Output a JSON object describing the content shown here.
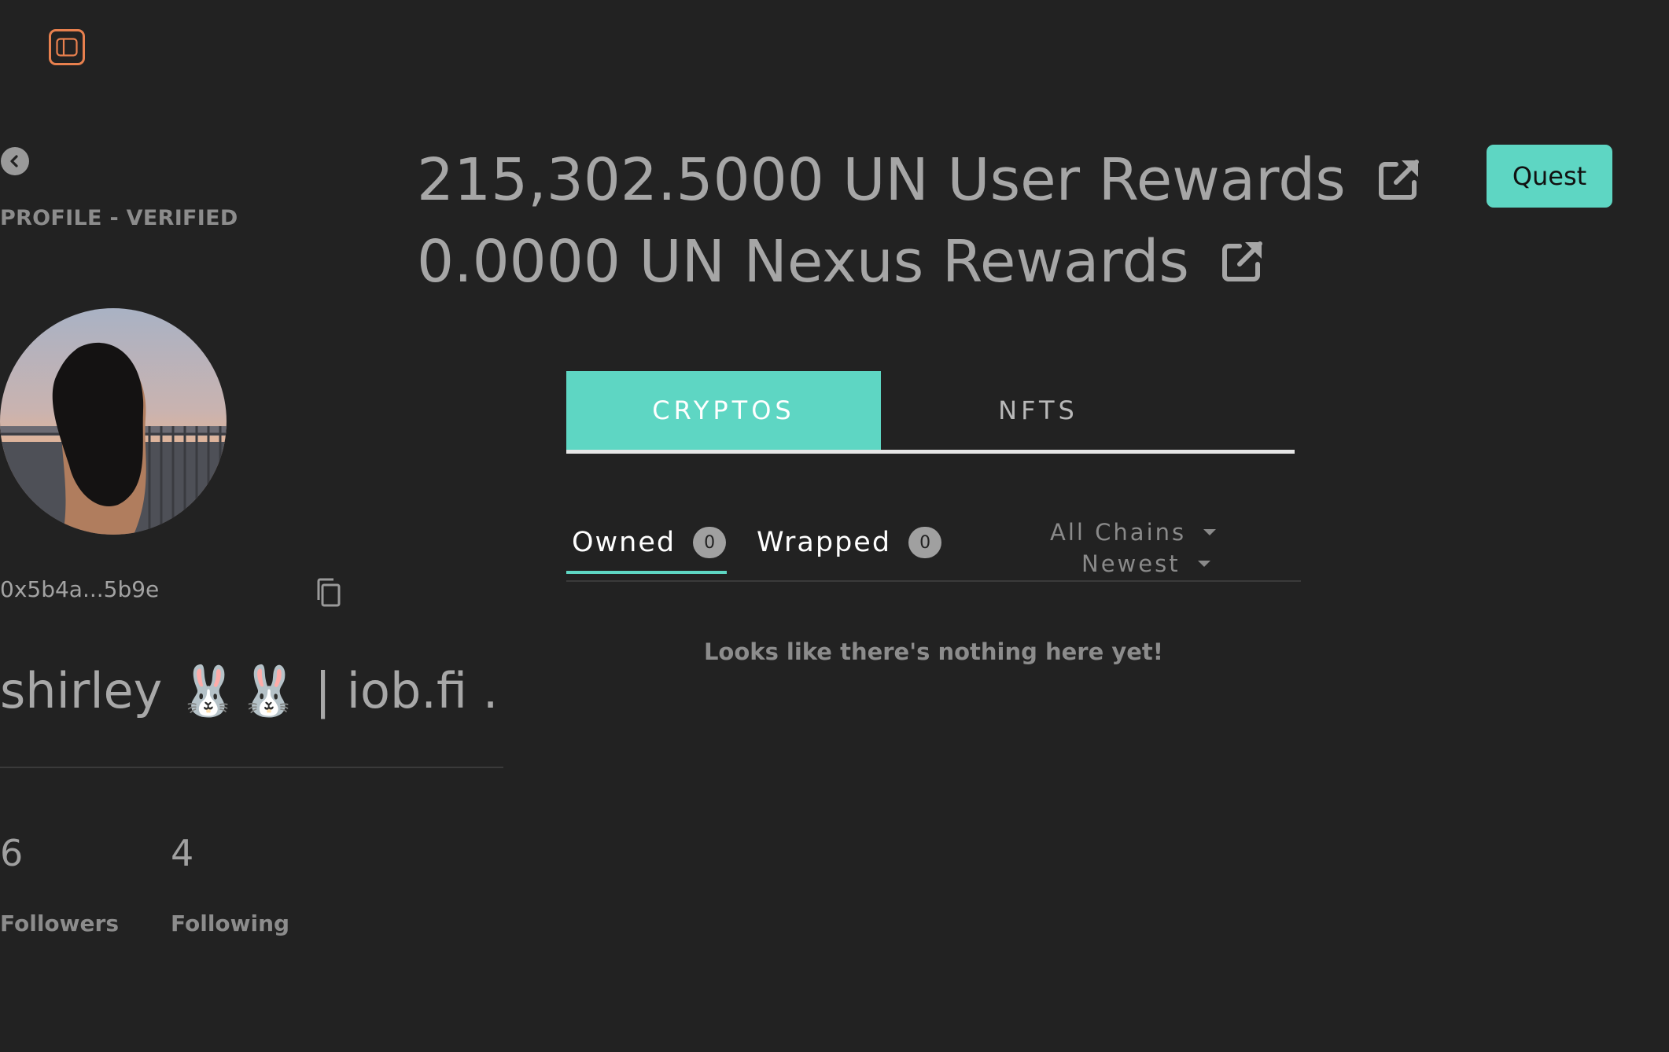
{
  "sidebar_toggle": {
    "icon": "sidebar-panel-icon"
  },
  "profile": {
    "back_icon": "chevron-left-icon",
    "status": "PROFILE - VERIFIED",
    "address": "0x5b4a...5b9e",
    "copy_icon": "copy-icon",
    "display_name": "shirley 🐰🐰 | iob.fi ...",
    "followers_count": "6",
    "followers_label": "Followers",
    "following_count": "4",
    "following_label": "Following"
  },
  "rewards": {
    "user_rewards": "215,302.5000 UN User Rewards",
    "nexus_rewards": "0.0000 UN Nexus Rewards",
    "link_icon": "external-link-icon"
  },
  "quest_button": "Quest",
  "main_tabs": [
    {
      "label": "CRYPTOS",
      "active": true
    },
    {
      "label": "NFTS",
      "active": false
    }
  ],
  "sub_tabs": [
    {
      "label": "Owned",
      "count": "0",
      "active": true
    },
    {
      "label": "Wrapped",
      "count": "0",
      "active": false
    }
  ],
  "filters": {
    "chain": "All Chains",
    "sort": "Newest"
  },
  "empty_message": "Looks like there's nothing here yet!",
  "colors": {
    "background": "#222222",
    "accent": "#5ed6c3",
    "toggle_border": "#e8804e"
  }
}
